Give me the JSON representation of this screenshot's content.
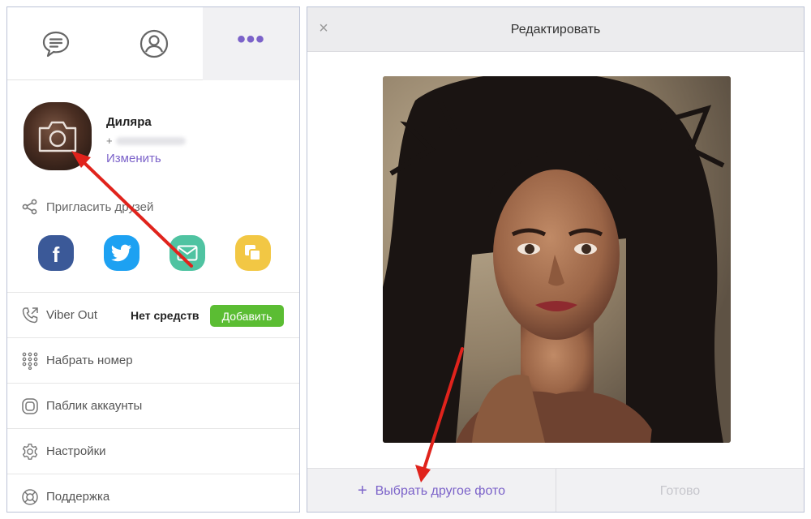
{
  "sidebar": {
    "tabs": [
      {
        "name": "chats",
        "icon": "chat-bubble-icon"
      },
      {
        "name": "contacts",
        "icon": "user-circle-icon"
      },
      {
        "name": "more",
        "icon": "more-dots-icon",
        "glyph": "•••",
        "active": true
      }
    ],
    "profile": {
      "name": "Диляра",
      "phone_prefix": "+",
      "edit_label": "Изменить"
    },
    "invite_label": "Пригласить друзей",
    "share_buttons": [
      {
        "name": "facebook",
        "color": "#3b5998"
      },
      {
        "name": "twitter",
        "color": "#1da1f2"
      },
      {
        "name": "email",
        "color": "#4fc3a1"
      },
      {
        "name": "copy-link",
        "color": "#f2c744"
      }
    ],
    "facebook_letter": "f",
    "viber_out": {
      "label": "Viber Out",
      "balance": "Нет средств",
      "add_label": "Добавить"
    },
    "menu": [
      {
        "label": "Набрать номер",
        "icon": "dialpad-icon"
      },
      {
        "label": "Паблик аккаунты",
        "icon": "public-accounts-icon"
      },
      {
        "label": "Настройки",
        "icon": "gear-icon"
      },
      {
        "label": "Поддержка",
        "icon": "lifebuoy-icon"
      }
    ]
  },
  "editor": {
    "close_glyph": "×",
    "title": "Редактировать",
    "choose_plus": "+",
    "choose_label": "Выбрать другое фото",
    "done_label": "Готово"
  },
  "colors": {
    "accent": "#7b62c9",
    "add_button": "#5bbd33",
    "annotation_arrow": "#e0231c"
  }
}
